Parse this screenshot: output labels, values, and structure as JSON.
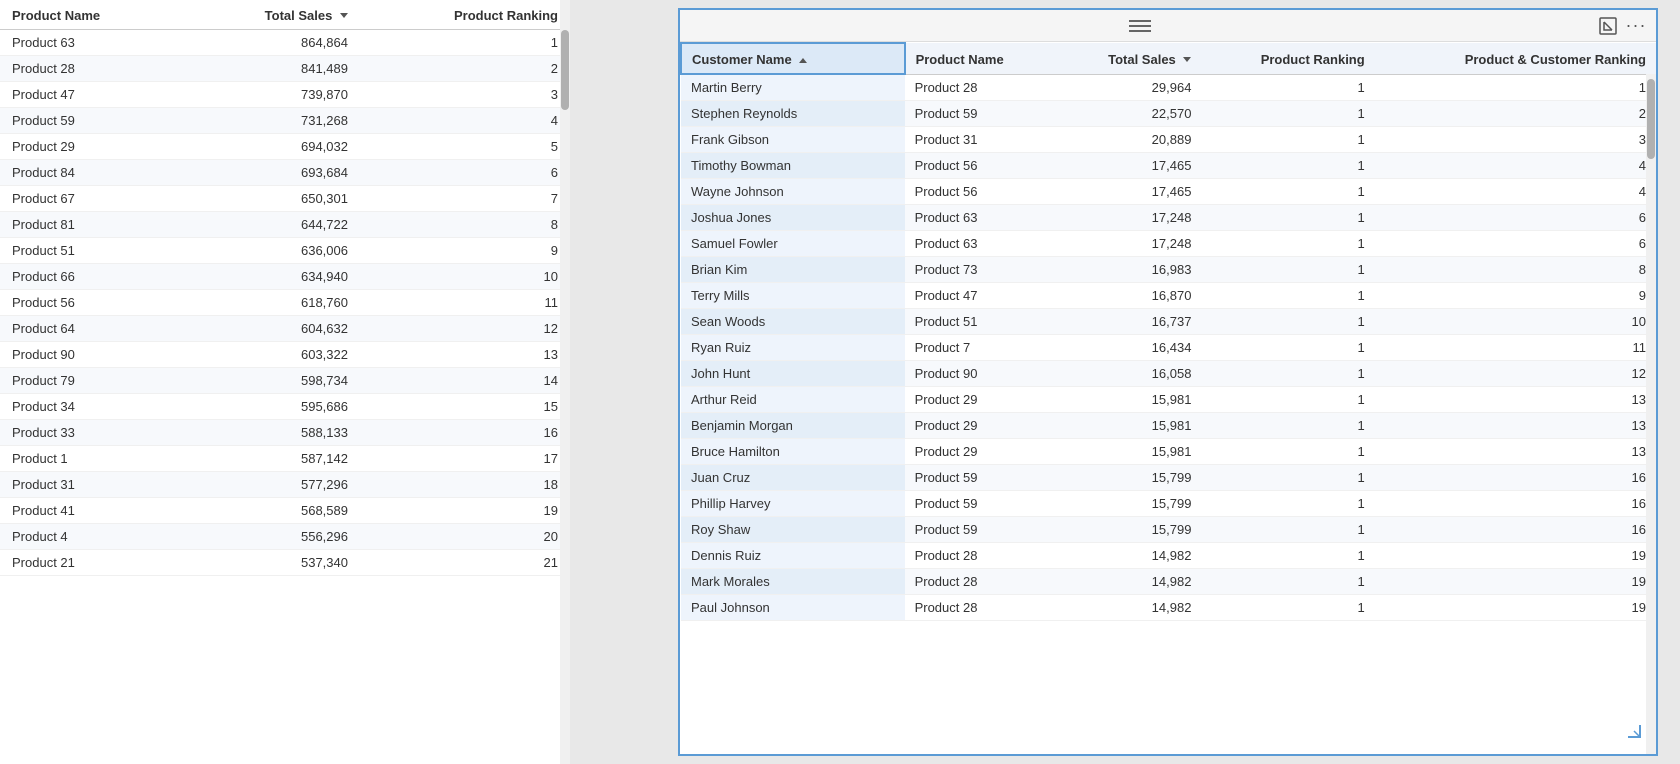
{
  "left_table": {
    "columns": [
      {
        "label": "Product Name",
        "key": "product_name",
        "align": "left"
      },
      {
        "label": "Total Sales",
        "key": "total_sales",
        "align": "right",
        "sort": "desc"
      },
      {
        "label": "Product Ranking",
        "key": "product_ranking",
        "align": "right"
      }
    ],
    "rows": [
      {
        "product_name": "Product 63",
        "total_sales": "864,864",
        "product_ranking": "1"
      },
      {
        "product_name": "Product 28",
        "total_sales": "841,489",
        "product_ranking": "2"
      },
      {
        "product_name": "Product 47",
        "total_sales": "739,870",
        "product_ranking": "3"
      },
      {
        "product_name": "Product 59",
        "total_sales": "731,268",
        "product_ranking": "4"
      },
      {
        "product_name": "Product 29",
        "total_sales": "694,032",
        "product_ranking": "5"
      },
      {
        "product_name": "Product 84",
        "total_sales": "693,684",
        "product_ranking": "6"
      },
      {
        "product_name": "Product 67",
        "total_sales": "650,301",
        "product_ranking": "7"
      },
      {
        "product_name": "Product 81",
        "total_sales": "644,722",
        "product_ranking": "8"
      },
      {
        "product_name": "Product 51",
        "total_sales": "636,006",
        "product_ranking": "9"
      },
      {
        "product_name": "Product 66",
        "total_sales": "634,940",
        "product_ranking": "10"
      },
      {
        "product_name": "Product 56",
        "total_sales": "618,760",
        "product_ranking": "11"
      },
      {
        "product_name": "Product 64",
        "total_sales": "604,632",
        "product_ranking": "12"
      },
      {
        "product_name": "Product 90",
        "total_sales": "603,322",
        "product_ranking": "13"
      },
      {
        "product_name": "Product 79",
        "total_sales": "598,734",
        "product_ranking": "14"
      },
      {
        "product_name": "Product 34",
        "total_sales": "595,686",
        "product_ranking": "15"
      },
      {
        "product_name": "Product 33",
        "total_sales": "588,133",
        "product_ranking": "16"
      },
      {
        "product_name": "Product 1",
        "total_sales": "587,142",
        "product_ranking": "17"
      },
      {
        "product_name": "Product 31",
        "total_sales": "577,296",
        "product_ranking": "18"
      },
      {
        "product_name": "Product 41",
        "total_sales": "568,589",
        "product_ranking": "19"
      },
      {
        "product_name": "Product 4",
        "total_sales": "556,296",
        "product_ranking": "20"
      },
      {
        "product_name": "Product 21",
        "total_sales": "537,340",
        "product_ranking": "21"
      }
    ]
  },
  "right_panel": {
    "topbar": {
      "expand_icon": "⊞",
      "more_icon": "···"
    },
    "columns": [
      {
        "label": "Customer Name",
        "key": "customer_name",
        "align": "left",
        "sort": "asc",
        "selected": true
      },
      {
        "label": "Product Name",
        "key": "product_name",
        "align": "left"
      },
      {
        "label": "Total Sales",
        "key": "total_sales",
        "align": "right",
        "sort": "desc"
      },
      {
        "label": "Product Ranking",
        "key": "product_ranking",
        "align": "right"
      },
      {
        "label": "Product & Customer Ranking",
        "key": "pc_ranking",
        "align": "right"
      }
    ],
    "rows": [
      {
        "customer_name": "Martin Berry",
        "product_name": "Product 28",
        "total_sales": "29,964",
        "product_ranking": "1",
        "pc_ranking": "1"
      },
      {
        "customer_name": "Stephen Reynolds",
        "product_name": "Product 59",
        "total_sales": "22,570",
        "product_ranking": "1",
        "pc_ranking": "2"
      },
      {
        "customer_name": "Frank Gibson",
        "product_name": "Product 31",
        "total_sales": "20,889",
        "product_ranking": "1",
        "pc_ranking": "3"
      },
      {
        "customer_name": "Timothy Bowman",
        "product_name": "Product 56",
        "total_sales": "17,465",
        "product_ranking": "1",
        "pc_ranking": "4"
      },
      {
        "customer_name": "Wayne Johnson",
        "product_name": "Product 56",
        "total_sales": "17,465",
        "product_ranking": "1",
        "pc_ranking": "4"
      },
      {
        "customer_name": "Joshua Jones",
        "product_name": "Product 63",
        "total_sales": "17,248",
        "product_ranking": "1",
        "pc_ranking": "6"
      },
      {
        "customer_name": "Samuel Fowler",
        "product_name": "Product 63",
        "total_sales": "17,248",
        "product_ranking": "1",
        "pc_ranking": "6"
      },
      {
        "customer_name": "Brian Kim",
        "product_name": "Product 73",
        "total_sales": "16,983",
        "product_ranking": "1",
        "pc_ranking": "8"
      },
      {
        "customer_name": "Terry Mills",
        "product_name": "Product 47",
        "total_sales": "16,870",
        "product_ranking": "1",
        "pc_ranking": "9"
      },
      {
        "customer_name": "Sean Woods",
        "product_name": "Product 51",
        "total_sales": "16,737",
        "product_ranking": "1",
        "pc_ranking": "10"
      },
      {
        "customer_name": "Ryan Ruiz",
        "product_name": "Product 7",
        "total_sales": "16,434",
        "product_ranking": "1",
        "pc_ranking": "11"
      },
      {
        "customer_name": "John Hunt",
        "product_name": "Product 90",
        "total_sales": "16,058",
        "product_ranking": "1",
        "pc_ranking": "12"
      },
      {
        "customer_name": "Arthur Reid",
        "product_name": "Product 29",
        "total_sales": "15,981",
        "product_ranking": "1",
        "pc_ranking": "13"
      },
      {
        "customer_name": "Benjamin Morgan",
        "product_name": "Product 29",
        "total_sales": "15,981",
        "product_ranking": "1",
        "pc_ranking": "13"
      },
      {
        "customer_name": "Bruce Hamilton",
        "product_name": "Product 29",
        "total_sales": "15,981",
        "product_ranking": "1",
        "pc_ranking": "13"
      },
      {
        "customer_name": "Juan Cruz",
        "product_name": "Product 59",
        "total_sales": "15,799",
        "product_ranking": "1",
        "pc_ranking": "16"
      },
      {
        "customer_name": "Phillip Harvey",
        "product_name": "Product 59",
        "total_sales": "15,799",
        "product_ranking": "1",
        "pc_ranking": "16"
      },
      {
        "customer_name": "Roy Shaw",
        "product_name": "Product 59",
        "total_sales": "15,799",
        "product_ranking": "1",
        "pc_ranking": "16"
      },
      {
        "customer_name": "Dennis Ruiz",
        "product_name": "Product 28",
        "total_sales": "14,982",
        "product_ranking": "1",
        "pc_ranking": "19"
      },
      {
        "customer_name": "Mark Morales",
        "product_name": "Product 28",
        "total_sales": "14,982",
        "product_ranking": "1",
        "pc_ranking": "19"
      },
      {
        "customer_name": "Paul Johnson",
        "product_name": "Product 28",
        "total_sales": "14,982",
        "product_ranking": "1",
        "pc_ranking": "19"
      }
    ]
  }
}
